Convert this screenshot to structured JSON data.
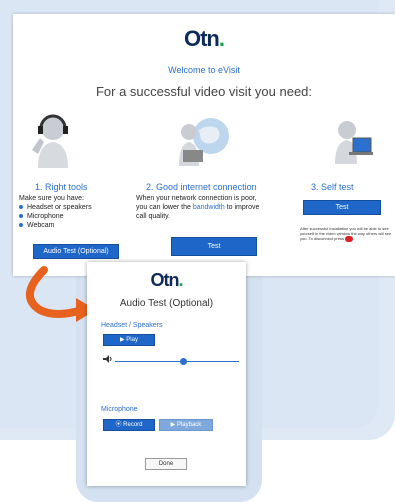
{
  "brand": {
    "logo_main": "Otn",
    "logo_dot": "."
  },
  "page": {
    "welcome": "Welcome to eVisit",
    "heading": "For a successful video visit you need:"
  },
  "columns": {
    "right_tools": {
      "title": "1. Right tools",
      "intro": "Make sure you have:",
      "items": [
        "Headset or speakers",
        "Microphone",
        "Webcam"
      ],
      "button": "Audio Test (Optional)"
    },
    "internet": {
      "title": "2. Good internet connection",
      "text_before": "When your network connection is poor, you can lower the ",
      "link": "bandwidth",
      "text_after": " to improve call quality.",
      "button": "Test"
    },
    "self_test": {
      "title": "3. Self test",
      "button": "Test",
      "note": "After successful installation you will be able to see yourself in the video window the way others will see you. To disconnect press"
    }
  },
  "popup": {
    "logo_main": "Otn",
    "title": "Audio Test (Optional)",
    "headset_label": "Headset / Speakers",
    "play_button": "▶ Play",
    "volume_level": 0.55,
    "microphone_label": "Microphone",
    "record_button": "⦿ Record",
    "playback_button": "▶ Playback",
    "done_button": "Done"
  },
  "colors": {
    "accent": "#1f66c9",
    "arrow": "#e8621f",
    "panel": "#dbe6f4"
  }
}
